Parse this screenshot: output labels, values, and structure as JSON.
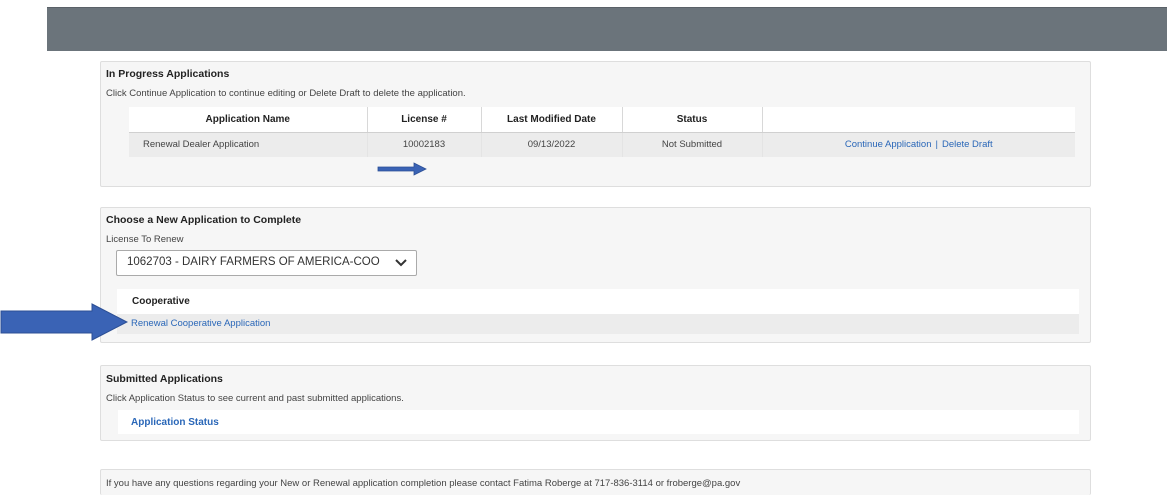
{
  "in_progress": {
    "title": "In Progress Applications",
    "description": "Click Continue Application to continue editing or Delete Draft to delete the application.",
    "columns": [
      "Application Name",
      "License #",
      "Last Modified Date",
      "Status",
      ""
    ],
    "rows": [
      {
        "name": "Renewal Dealer Application",
        "license": "10002183",
        "modified": "09/13/2022",
        "status": "Not Submitted",
        "continue_label": "Continue Application",
        "separator": "|",
        "delete_label": "Delete Draft"
      }
    ]
  },
  "new_application": {
    "title": "Choose a New Application to Complete",
    "license_label": "License To Renew",
    "license_selected": "1062703 - DAIRY FARMERS OF AMERICA-COO",
    "category": "Cooperative",
    "link_label": "Renewal Cooperative Application"
  },
  "submitted": {
    "title": "Submitted Applications",
    "description": "Click Application Status to see current and past submitted applications.",
    "status_link": "Application Status"
  },
  "contact": {
    "text": "If you have any questions regarding your New or Renewal application completion please contact Fatima Roberge at 717-836-3114 or froberge@pa.gov"
  },
  "colors": {
    "header_bar": "#6b747b",
    "link": "#2a67b8",
    "arrow": "#3a63b5"
  }
}
